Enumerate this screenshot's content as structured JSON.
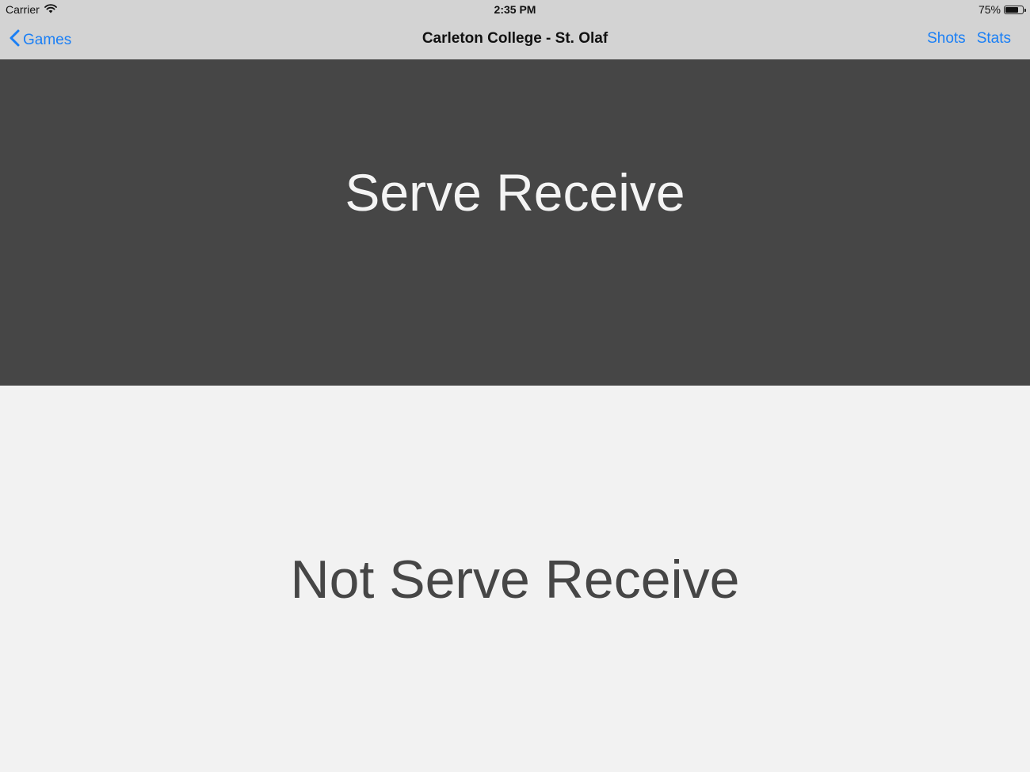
{
  "status_bar": {
    "carrier": "Carrier",
    "time": "2:35 PM",
    "battery_percent": "75%",
    "battery_level": 0.75,
    "wifi_icon": "wifi-icon",
    "battery_icon": "battery-icon"
  },
  "nav": {
    "back_label": "Games",
    "back_icon": "chevron-left-icon",
    "title": "Carleton College - St. Olaf",
    "shots_label": "Shots",
    "stats_label": "Stats"
  },
  "panels": {
    "top_label": "Serve Receive",
    "bottom_label": "Not Serve Receive"
  },
  "colors": {
    "accent": "#1a7ff5",
    "bar_background": "#d3d3d3",
    "dark_panel": "#464646",
    "light_panel": "#f2f2f2"
  }
}
